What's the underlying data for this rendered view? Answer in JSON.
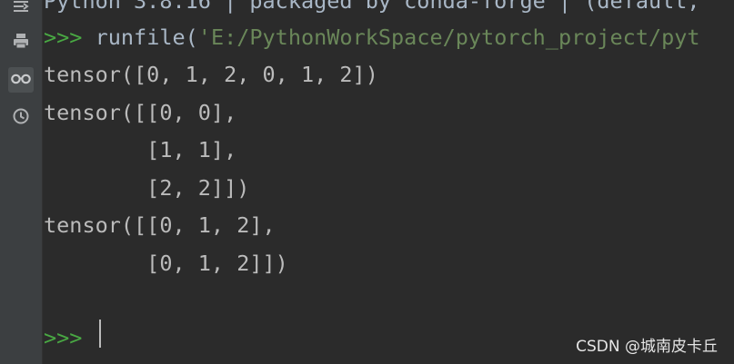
{
  "console": {
    "header": "Python 3.8.16 | packaged by conda-forge | (default,",
    "prompt": ">>>",
    "command": {
      "call": " runfile(",
      "path": "'E:/PythonWorkSpace/pytorch_project/pyt"
    },
    "output": [
      "tensor([0, 1, 2, 0, 1, 2])",
      "tensor([[0, 0],",
      "        [1, 1],",
      "        [2, 2]])",
      "tensor([[0, 1, 2],",
      "        [0, 1, 2]])"
    ],
    "input_prompt": ">>>",
    "input_value": ""
  },
  "toolbar": {
    "icons": [
      "soft-wrap-icon",
      "print-icon",
      "view-variables-icon",
      "history-icon"
    ],
    "active_icon": "view-variables-icon"
  },
  "watermark": {
    "text": "CSDN @城南皮卡丘"
  },
  "colors": {
    "background": "#2b2b2b",
    "toolbar": "#3c3f41",
    "prompt": "#49a843",
    "string": "#6a8759",
    "text": "#bbbbbb"
  }
}
